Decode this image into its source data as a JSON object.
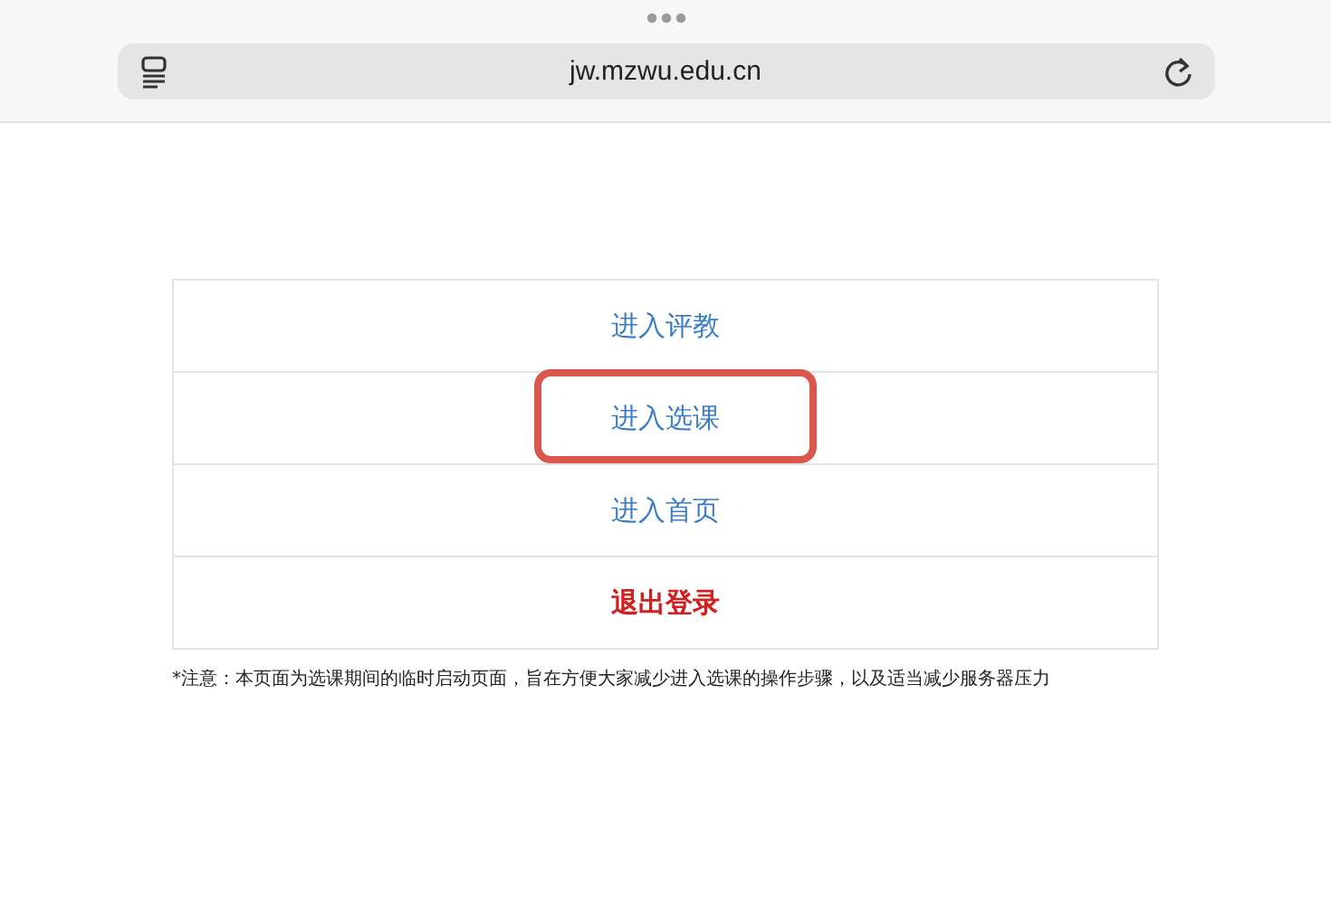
{
  "browser": {
    "address": "jw.mzwu.edu.cn"
  },
  "menu": [
    {
      "label": "进入评教",
      "kind": "link",
      "highlighted": false
    },
    {
      "label": "进入选课",
      "kind": "link",
      "highlighted": true
    },
    {
      "label": "进入首页",
      "kind": "link",
      "highlighted": false
    },
    {
      "label": "退出登录",
      "kind": "logout",
      "highlighted": false
    }
  ],
  "note": "*注意：本页面为选课期间的临时启动页面，旨在方便大家减少进入选课的操作步骤，以及适当减少服务器压力"
}
